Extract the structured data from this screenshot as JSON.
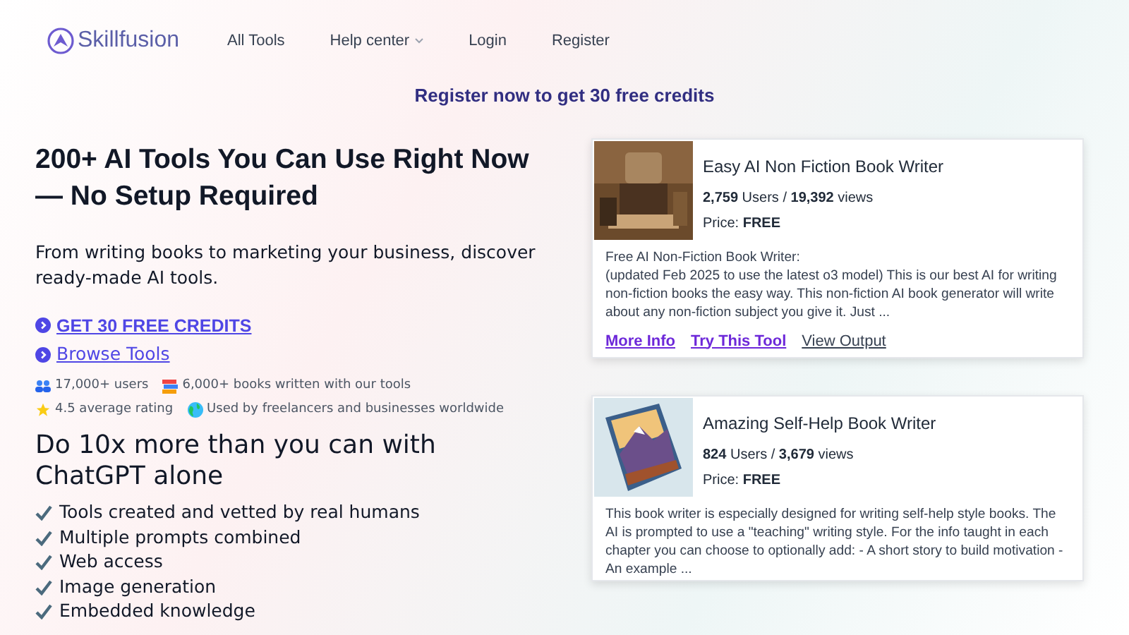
{
  "nav": {
    "brand": "Skillfusion",
    "links": [
      {
        "label": "All Tools",
        "kind": "link"
      },
      {
        "label": "Help center",
        "kind": "dropdown"
      },
      {
        "label": "Login",
        "kind": "link"
      },
      {
        "label": "Register",
        "kind": "link"
      }
    ]
  },
  "banner": "Register now to get 30 free credits",
  "hero": {
    "title": "200+ AI Tools You Can Use Right Now — No Setup Required",
    "subtitle": "From writing books to marketing your business, discover ready-made AI tools.",
    "ctas": [
      "GET 30 FREE CREDITS",
      "Browse Tools"
    ],
    "stats": [
      [
        {
          "kind": "users",
          "text": "17,000+ users"
        },
        {
          "kind": "books",
          "text": "6,000+ books written with our tools"
        }
      ],
      [
        {
          "kind": "rating",
          "text": "4.5 average rating"
        },
        {
          "kind": "reach",
          "text": "Used by freelancers and businesses worldwide"
        }
      ]
    ]
  },
  "features": {
    "title": "Do 10x more than you can with ChatGPT alone",
    "items": [
      "Tools created and vetted by real humans",
      "Multiple prompts combined",
      "Web access",
      "Image generation",
      "Embedded knowledge"
    ]
  },
  "tools": [
    {
      "title": "Easy AI Non Fiction Book Writer",
      "stats": "**2,759** Users / **19,392** views",
      "price": "Price: **FREE**",
      "description": "Free AI Non-Fiction Book Writer:\n(updated Feb 2025 to use the latest o3 model) This is our best AI for writing non-fiction books the easy way. This non-fiction AI book generator will write about any non-fiction subject you give it. Just ...",
      "links": [
        "More Info",
        "Try This Tool",
        "View Output"
      ]
    },
    {
      "title": "Amazing Self-Help Book Writer",
      "stats": "**824** Users / **3,679** views",
      "price": "Price: **FREE**",
      "description": "This book writer is especially designed for writing self-help style books. The AI is prompted to use a \"teaching\" writing style. For the info taught in each chapter you can choose to optionally add: - A short story to build motivation - An example ..."
    }
  ]
}
